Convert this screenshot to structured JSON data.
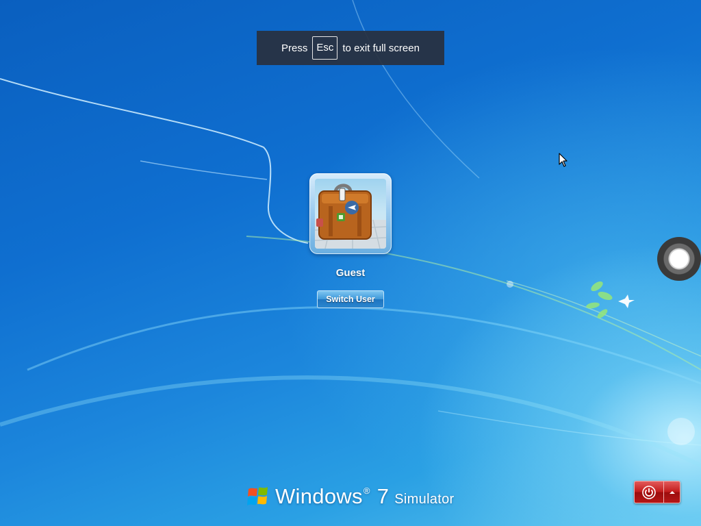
{
  "fullscreen_notice": {
    "before_key": "Press",
    "key": "Esc",
    "after_key": "to exit full screen"
  },
  "user": {
    "name": "Guest",
    "picture": "suitcase-with-travel-stickers"
  },
  "switch_user_label": "Switch User",
  "branding": {
    "product": "Windows",
    "registered": "®",
    "version": "7",
    "suffix": "Simulator"
  },
  "icons": {
    "power": "power-icon",
    "options": "triangle-up-icon",
    "logo": "windows-flag-icon",
    "circle": "circle-button-icon",
    "cursor": "mouse-pointer-icon"
  },
  "colors": {
    "background_deep": "#0a5fbf",
    "background_glow": "#5cc4ee",
    "power_button": "#c21a1a",
    "notice_bar": "#28303e"
  }
}
